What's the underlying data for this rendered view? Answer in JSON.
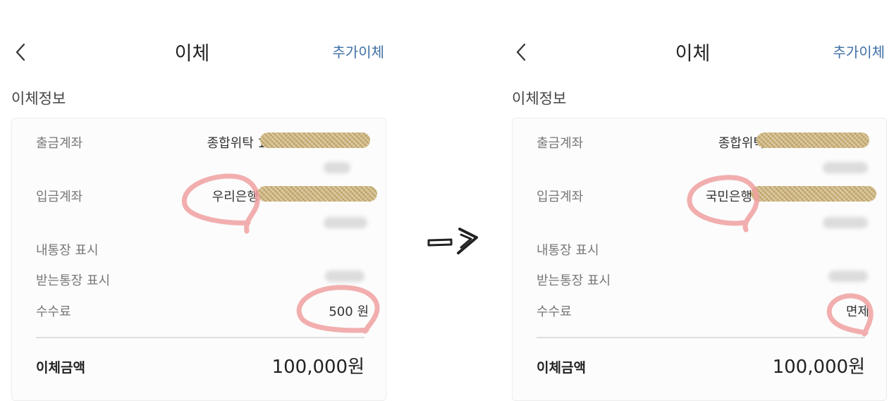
{
  "screens": [
    {
      "header": {
        "back_icon": "chevron-left-icon",
        "title": "이체",
        "add_transfer": "추가이체"
      },
      "section_title": "이체정보",
      "rows": {
        "withdraw_label": "출금계좌",
        "withdraw_value": "종합위탁 1",
        "deposit_label": "입금계좌",
        "deposit_value": "우리은행",
        "my_display_label": "내통장 표시",
        "recipient_display_label": "받는통장 표시",
        "fee_label": "수수료",
        "fee_value": "500 원"
      },
      "amount": {
        "label": "이체금액",
        "value": "100,000원"
      }
    },
    {
      "header": {
        "back_icon": "chevron-left-icon",
        "title": "이체",
        "add_transfer": "추가이체"
      },
      "section_title": "이체정보",
      "rows": {
        "withdraw_label": "출금계좌",
        "withdraw_value": "종합위탁",
        "deposit_label": "입금계좌",
        "deposit_value": "국민은행",
        "my_display_label": "내통장 표시",
        "recipient_display_label": "받는통장 표시",
        "fee_label": "수수료",
        "fee_value": "면제"
      },
      "amount": {
        "label": "이체금액",
        "value": "100,000원"
      }
    }
  ],
  "annotation_color": "#f0a0a0",
  "arrow_icon": "hand-drawn-arrow-right-icon"
}
